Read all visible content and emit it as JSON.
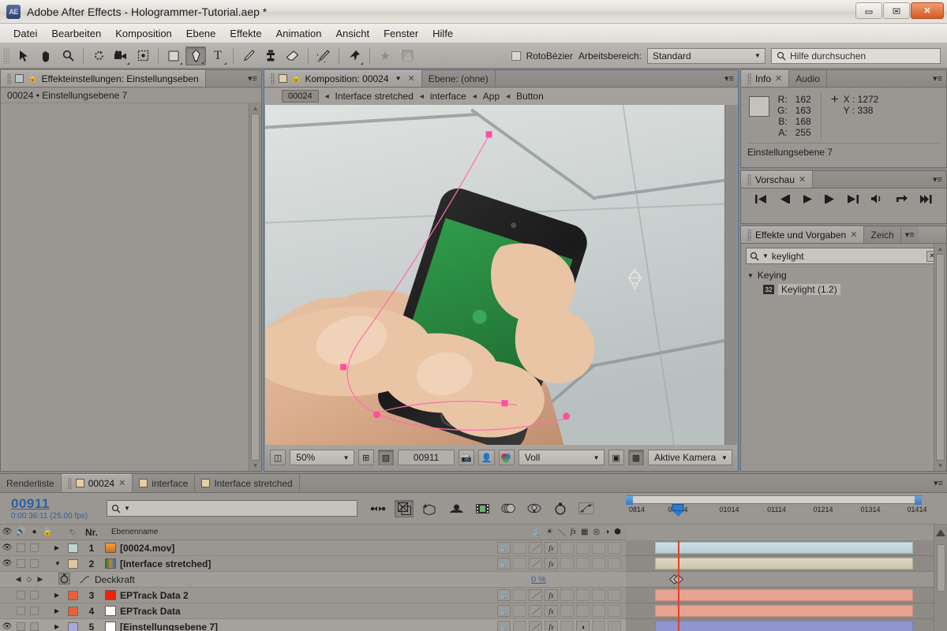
{
  "window": {
    "title": "Adobe After Effects - Hologrammer-Tutorial.aep *",
    "logo": "AE",
    "minimize": "—",
    "restore": "❐",
    "close": "✕"
  },
  "menubar": {
    "items": [
      "Datei",
      "Bearbeiten",
      "Komposition",
      "Ebene",
      "Effekte",
      "Animation",
      "Ansicht",
      "Fenster",
      "Hilfe"
    ]
  },
  "toolbar": {
    "tools": [
      {
        "name": "selection-tool",
        "glyph": "➤",
        "active": false
      },
      {
        "name": "hand-tool",
        "glyph": "✋",
        "active": false
      },
      {
        "name": "zoom-tool",
        "glyph": "🔍",
        "active": false
      },
      {
        "name": "rotation-tool",
        "glyph": "↻",
        "active": false
      },
      {
        "name": "camera-tool",
        "glyph": "🎥",
        "active": false
      },
      {
        "name": "pan-behind-tool",
        "glyph": "✥",
        "active": false
      },
      {
        "name": "shape-tool",
        "glyph": "▢",
        "active": false
      },
      {
        "name": "pen-tool",
        "glyph": "✒",
        "active": true
      },
      {
        "name": "type-tool",
        "glyph": "T",
        "active": false
      },
      {
        "name": "brush-tool",
        "glyph": "✏",
        "active": false
      },
      {
        "name": "clone-stamp-tool",
        "glyph": "⚱",
        "active": false
      },
      {
        "name": "eraser-tool",
        "glyph": "◣",
        "active": false
      },
      {
        "name": "roto-brush-tool",
        "glyph": "🖌",
        "active": false
      },
      {
        "name": "puppet-pin-tool",
        "glyph": "📌",
        "active": false
      },
      {
        "name": "favorite-star",
        "glyph": "★",
        "active": false
      },
      {
        "name": "comp-button",
        "glyph": "◩",
        "active": false
      }
    ],
    "rotobezier_label": "RotoBézier",
    "workspace_label": "Arbeitsbereich:",
    "workspace_value": "Standard",
    "help_placeholder": "Hilfe durchsuchen",
    "help_value": "Hilfe durchsuchen"
  },
  "effect_controls": {
    "tab_label": "Effekteinstellungen: Einstellungseben",
    "subtitle": "00024 • Einstellungsebene 7"
  },
  "composition": {
    "tab_label": "Komposition: 00024",
    "tab_layer": "Ebene: (ohne)",
    "breadcrumbs": [
      "00024",
      "Interface stretched",
      "interface",
      "App",
      "Button"
    ],
    "bottom": {
      "zoom": "50%",
      "time": "00911",
      "quality": "Voll",
      "camera": "Aktive Kamera"
    }
  },
  "info": {
    "tab_label": "Info",
    "tab_audio": "Audio",
    "channels": [
      {
        "label": "R:",
        "value": "162"
      },
      {
        "label": "G:",
        "value": "163"
      },
      {
        "label": "B:",
        "value": "168"
      },
      {
        "label": "A:",
        "value": "255"
      }
    ],
    "x_label": "X : 1272",
    "y_label": "Y : 338",
    "footer": "Einstellungsebene 7",
    "swatch_color": "#a2a3a8"
  },
  "preview": {
    "tab_label": "Vorschau",
    "buttons": [
      {
        "name": "first-frame-button",
        "glyph": "⏮"
      },
      {
        "name": "previous-frame-button",
        "glyph": "◀|"
      },
      {
        "name": "play-button",
        "glyph": "▶"
      },
      {
        "name": "next-frame-button",
        "glyph": "|▶"
      },
      {
        "name": "last-frame-button",
        "glyph": "⏭"
      },
      {
        "name": "audio-button",
        "glyph": "🔊"
      },
      {
        "name": "loop-button",
        "glyph": "⤴"
      },
      {
        "name": "ram-preview-button",
        "glyph": "⫸"
      }
    ]
  },
  "effects_presets": {
    "tab_label": "Effekte und Vorgaben",
    "tab_paint": "Zeich",
    "search_value": "keylight",
    "search_clear": "✕",
    "category": "Keying",
    "item_label": "Keylight (1.2)",
    "item_badge": "32"
  },
  "timeline": {
    "tabs": [
      {
        "label": "Renderliste",
        "active": false,
        "has_swatch": false
      },
      {
        "label": "00024",
        "active": true,
        "has_swatch": true
      },
      {
        "label": "interface",
        "active": false,
        "has_swatch": true
      },
      {
        "label": "Interface stretched",
        "active": false,
        "has_swatch": true
      }
    ],
    "current_time": "00911",
    "time_sub": "0:00:36:11 (25.00 fps)",
    "search_placeholder": "",
    "toolbar_icons": [
      {
        "name": "toggle-switches-modes-icon",
        "glyph": "⇄",
        "active": false
      },
      {
        "name": "composition-mini-flowchart-icon",
        "glyph": "⊡",
        "active": true
      },
      {
        "name": "draft-3d-icon",
        "glyph": "✨",
        "active": false
      },
      {
        "name": "hide-shy-layers-icon",
        "glyph": "⛰",
        "active": false
      },
      {
        "name": "enable-frame-blending-icon",
        "glyph": "🎞",
        "active": false
      },
      {
        "name": "motion-blur-icon",
        "glyph": "◯",
        "active": false
      },
      {
        "name": "brainstorm-icon",
        "glyph": "💡",
        "active": false
      },
      {
        "name": "auto-keyframe-icon",
        "glyph": "⏱",
        "active": false
      },
      {
        "name": "graph-editor-icon",
        "glyph": "📈",
        "active": false
      }
    ],
    "columns": [
      "Nr.",
      "Ebenenname"
    ],
    "ruler_ticks": [
      "0814",
      "00914",
      "01014",
      "01114",
      "01214",
      "01314",
      "01414"
    ],
    "layers": [
      {
        "type": "layer",
        "visible": true,
        "number": "1",
        "name": "[00024.mov]",
        "label_color": "#bcd4d4",
        "swatch_color": "#e8a33d",
        "bar_color": "#c3dade",
        "expanded": false,
        "selected": false
      },
      {
        "type": "layer",
        "visible": true,
        "number": "2",
        "name": "[Interface stretched]",
        "label_color": "#dcc79a",
        "swatch_color": "#3f7a3f",
        "bar_color": "#d5cdb4",
        "expanded": true,
        "selected": false
      },
      {
        "type": "property",
        "name": "Deckkraft",
        "value": "0 %",
        "keyframe_at": "25%"
      },
      {
        "type": "layer",
        "visible": false,
        "number": "3",
        "name": "EPTrack Data 2",
        "label_color": "#e8603c",
        "swatch_color": "#ee2200",
        "bar_color": "#e59b89",
        "expanded": false,
        "selected": false
      },
      {
        "type": "layer",
        "visible": false,
        "number": "4",
        "name": "EPTrack Data",
        "label_color": "#e8603c",
        "swatch_color": "#ffffff",
        "bar_color": "#e59b89",
        "expanded": false,
        "selected": false
      },
      {
        "type": "layer",
        "visible": true,
        "number": "5",
        "name": "[Einstellungsebene 7]",
        "label_color": "#a8a8d8",
        "swatch_color": "#ffffff",
        "bar_color": "#8f92c9",
        "expanded": false,
        "selected": true
      }
    ]
  }
}
